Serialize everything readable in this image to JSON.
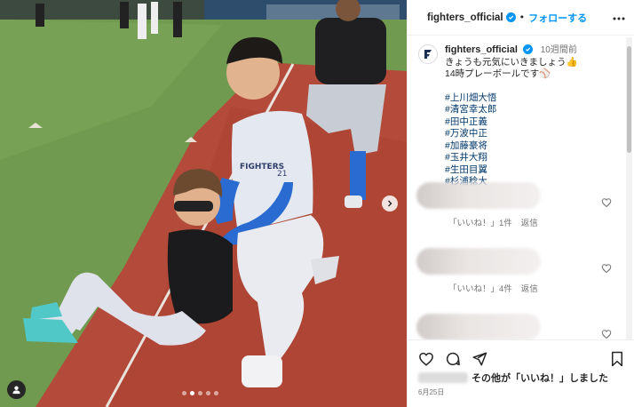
{
  "header": {
    "username": "fighters_official",
    "separator": "•",
    "follow_label": "フォローする"
  },
  "caption": {
    "username": "fighters_official",
    "time": "10週間前",
    "line1": "きょうも元気にいきましょう👍",
    "line2": "14時プレーボールです⚾",
    "hashtags": [
      "#上川畑大悟",
      "#清宮幸太郎",
      "#田中正義",
      "#万波中正",
      "#加藤豪将",
      "#玉井大翔",
      "#生田目翼",
      "#杉浦稔大"
    ]
  },
  "comments": [
    {
      "likes_label": "「いいね！」1件",
      "reply_label": "返信"
    },
    {
      "likes_label": "「いいね！」4件",
      "reply_label": "返信"
    },
    {
      "likes_label": "",
      "reply_label": ""
    }
  ],
  "footer": {
    "likes_text": "その他が「いいね！」しました",
    "date": "6月25日"
  },
  "photo": {
    "jersey_text": "FIGHTERS",
    "jersey_number": "21",
    "carousel_count": 5,
    "carousel_active": 1
  },
  "colors": {
    "accent": "#0095f6",
    "hashtag": "#00376b",
    "turf": "#b44a3a",
    "grass": "#6f9a4f",
    "jersey_blue": "#2a6bd1"
  },
  "icons": {
    "verified": "verified-badge-icon",
    "more": "more-horizontal-icon",
    "heart": "heart-icon",
    "comment": "comment-icon",
    "share": "paper-plane-icon",
    "save": "bookmark-icon",
    "next": "chevron-right-icon",
    "user_tag": "user-tag-icon"
  }
}
